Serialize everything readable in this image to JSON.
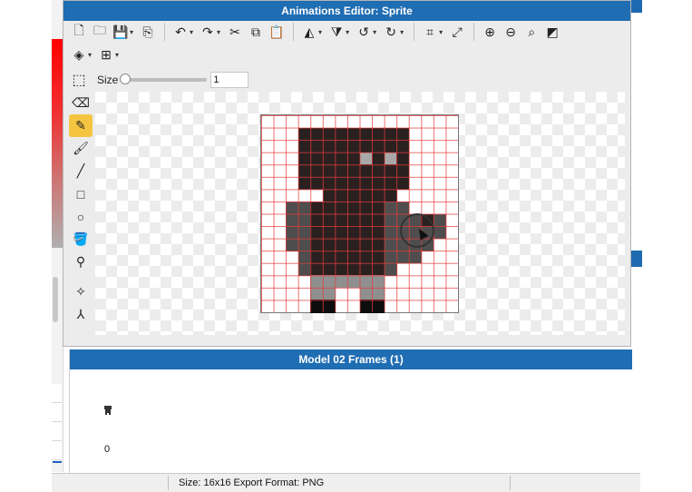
{
  "window": {
    "title": "Animations Editor: Sprite"
  },
  "toolbar": {
    "row1": [
      {
        "name": "new-file-icon",
        "glyph": "🗋"
      },
      {
        "name": "open-folder-icon",
        "glyph": "🗀"
      },
      {
        "name": "save-icon",
        "glyph": "💾",
        "dropdown": true
      },
      {
        "name": "export-icon",
        "glyph": "⎘"
      },
      {
        "sep": true
      },
      {
        "name": "undo-icon",
        "glyph": "↶",
        "dropdown": true
      },
      {
        "name": "redo-icon",
        "glyph": "↷",
        "dropdown": true
      },
      {
        "name": "cut-icon",
        "glyph": "✂"
      },
      {
        "name": "copy-icon",
        "glyph": "⧉"
      },
      {
        "name": "paste-icon",
        "glyph": "📋"
      },
      {
        "sep": true
      },
      {
        "name": "flip-horizontal-icon",
        "glyph": "◭",
        "dropdown": true
      },
      {
        "name": "flip-vertical-icon",
        "glyph": "⧩",
        "dropdown": true
      },
      {
        "name": "rotate-left-icon",
        "glyph": "↺",
        "dropdown": true
      },
      {
        "name": "rotate-right-icon",
        "glyph": "↻",
        "dropdown": true
      },
      {
        "sep": true
      },
      {
        "name": "crop-icon",
        "glyph": "⌗",
        "dropdown": true
      },
      {
        "name": "resize-icon",
        "glyph": "⤢"
      },
      {
        "sep": true
      },
      {
        "name": "zoom-in-icon",
        "glyph": "⊕"
      },
      {
        "name": "zoom-out-icon",
        "glyph": "⊖"
      },
      {
        "name": "zoom-fit-icon",
        "glyph": "⌕"
      },
      {
        "name": "background-toggle-icon",
        "glyph": "◩"
      }
    ],
    "row2": [
      {
        "name": "layers-icon",
        "glyph": "◈",
        "dropdown": true
      },
      {
        "name": "grid-icon",
        "glyph": "⊞",
        "dropdown": true
      }
    ]
  },
  "brush": {
    "size_label": "Size",
    "size_value": "1",
    "slider_level": 0
  },
  "tools": [
    {
      "name": "eraser-icon",
      "glyph": "⌫",
      "active": false
    },
    {
      "name": "pencil-icon",
      "glyph": "✎",
      "active": true
    },
    {
      "name": "brush-icon",
      "glyph": "🖌",
      "active": false
    },
    {
      "name": "line-icon",
      "glyph": "╱",
      "active": false
    },
    {
      "name": "rectangle-icon",
      "glyph": "□",
      "active": false
    },
    {
      "name": "ellipse-icon",
      "glyph": "○",
      "active": false
    },
    {
      "name": "fill-bucket-icon",
      "glyph": "🪣",
      "active": false
    },
    {
      "name": "eyedropper-icon",
      "glyph": "⚲",
      "active": false
    },
    {
      "sep": true
    },
    {
      "name": "move-anchor-icon",
      "glyph": "✧",
      "active": false
    },
    {
      "name": "skeleton-icon",
      "glyph": "⅄",
      "active": false
    }
  ],
  "colors": {
    "accent": "#1f6db3",
    "dark": "#2b2020",
    "medium": "#4f4d4d",
    "light": "#8f8f8f",
    "eye": "#a8a8a8",
    "black": "#0d0d0d",
    "grid": "#e63c3c"
  },
  "sprite": {
    "rows": [
      "................",
      "...DDDDDDDDD....",
      "...DDDDDDDDD....",
      "...DDDDDEDED....",
      "...DDDDDDDDD....",
      "...DDDDDDDDD....",
      ".....DDDDDD.....",
      "..MMKKKKKKMM....",
      "..MMKKKKKKMMMKM.",
      "..MMKKKKKKMMMMM.",
      "..MMKKKKKKMMMM..",
      "...MKKKKKKMMM...",
      "...MKKKKKKM.....",
      "....GGGGGG......",
      "....GG..GG......",
      "....BB..BB......"
    ]
  },
  "frames": {
    "title": "Model 02 Frames (1)",
    "items": [
      {
        "index": "0"
      }
    ]
  },
  "status": {
    "text": "Size: 16x16   Export Format: PNG"
  }
}
